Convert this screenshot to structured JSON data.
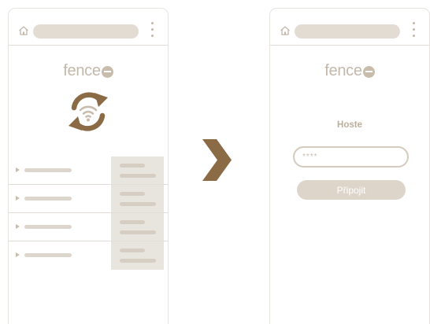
{
  "colors": {
    "accent": "#c3b8aa",
    "arrow": "#8a6b45",
    "frame_border": "#e7e3de",
    "url_bar": "#e2dcd3",
    "panel_bg": "#e8e4de",
    "button_bg": "#ddd5ca"
  },
  "left_screen": {
    "logo_text": "fence",
    "icons": {
      "home": "home-icon",
      "menu": "more-vertical-icon",
      "sync": "wifi-sync-icon"
    },
    "list_rows": [
      {
        "expander": "caret-right-icon"
      },
      {
        "expander": "caret-right-icon"
      },
      {
        "expander": "caret-right-icon"
      },
      {
        "expander": "caret-right-icon"
      }
    ]
  },
  "transition_icon": "chevron-right-icon",
  "right_screen": {
    "logo_text": "fence",
    "login_title": "Hoste",
    "password_placeholder": "****",
    "connect_label": "Připojit",
    "icons": {
      "home": "home-icon",
      "menu": "more-vertical-icon"
    }
  }
}
